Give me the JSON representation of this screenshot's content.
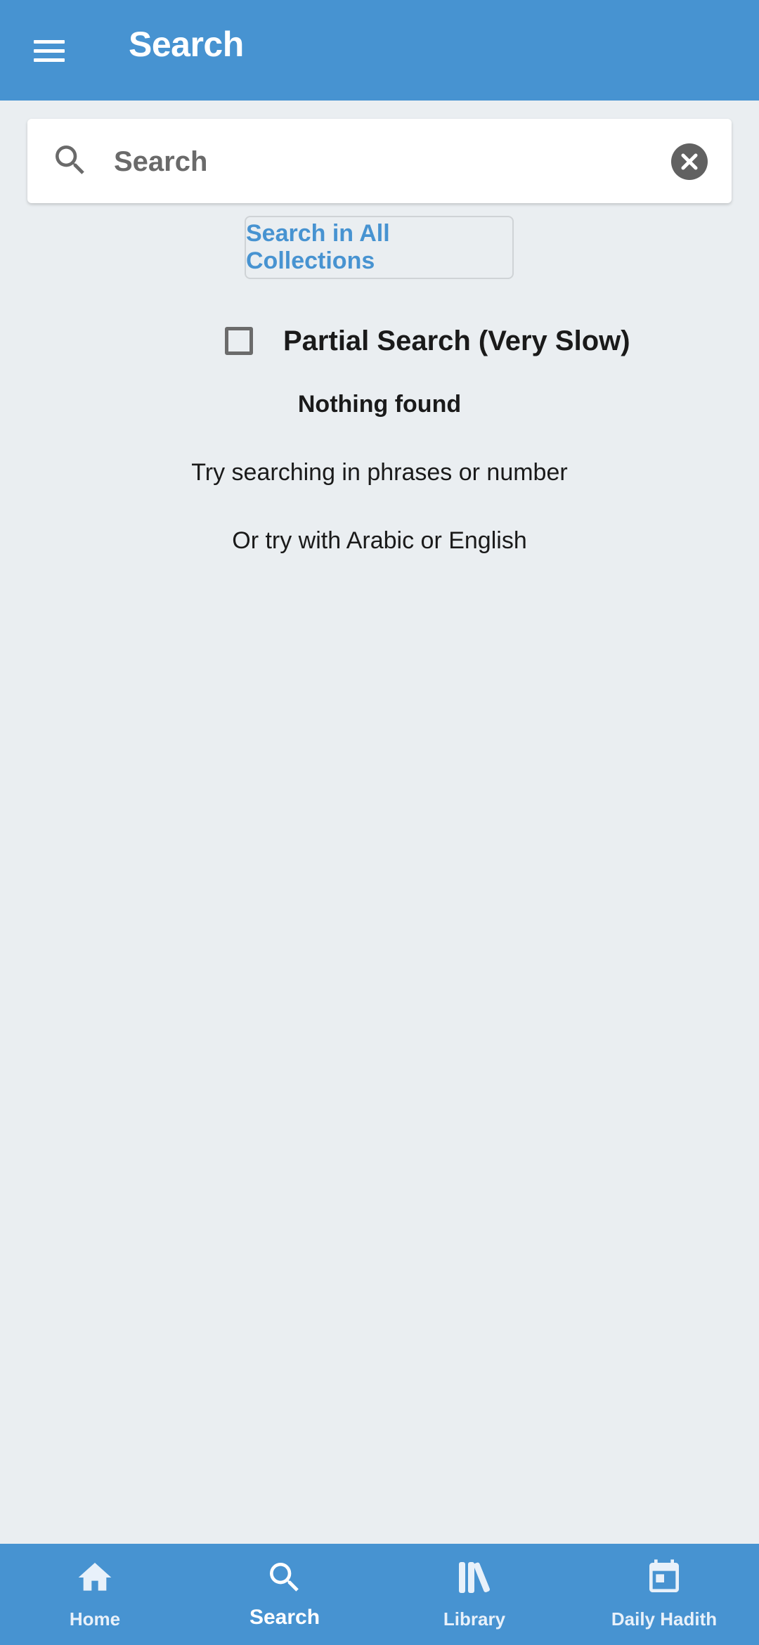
{
  "header": {
    "title": "Search",
    "menu_icon": "hamburger-menu-icon",
    "background": "#4793d1"
  },
  "search": {
    "placeholder": "Search",
    "value": "",
    "search_icon": "search-icon",
    "clear_icon": "clear-circle-icon"
  },
  "actions": {
    "all_collections_label": "Search in All Collections",
    "partial_search_label": "Partial Search (Very Slow)",
    "partial_search_checked": false
  },
  "results": {
    "empty_title": "Nothing found",
    "hint_1": "Try searching in phrases or number",
    "hint_2": "Or try with Arabic or English"
  },
  "bottom_nav": {
    "items": [
      {
        "label": "Home",
        "icon": "home-icon",
        "active": false
      },
      {
        "label": "Search",
        "icon": "search-icon",
        "active": true
      },
      {
        "label": "Library",
        "icon": "library-icon",
        "active": false
      },
      {
        "label": "Daily Hadith",
        "icon": "calendar-icon",
        "active": false
      }
    ]
  },
  "colors": {
    "accent": "#4793d1",
    "background": "#eaeef1",
    "text": "#1a1a1a"
  }
}
